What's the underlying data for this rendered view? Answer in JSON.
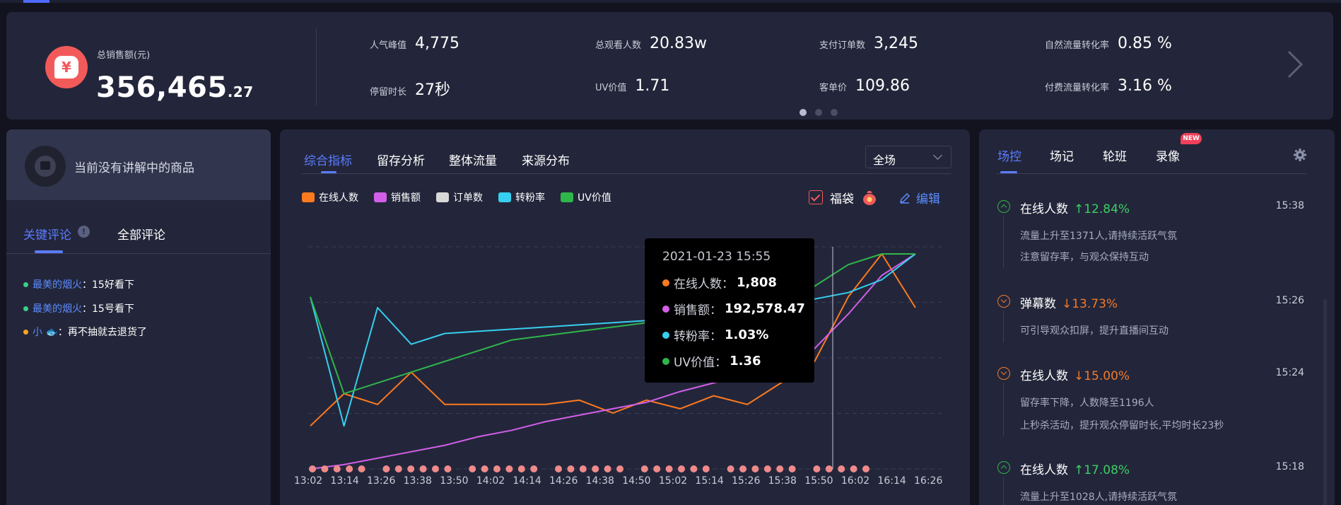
{
  "summary": {
    "total_label": "总销售额(元)",
    "total_int": "356,465",
    "total_dec": ".27",
    "stats": [
      {
        "label": "人气峰值",
        "value": "4,775"
      },
      {
        "label": "总观看人数",
        "value": "20.83w"
      },
      {
        "label": "支付订单数",
        "value": "3,245"
      },
      {
        "label": "自然流量转化率",
        "value": "0.85 %"
      },
      {
        "label": "停留时长",
        "value": "27秒"
      },
      {
        "label": "UV价值",
        "value": "1.71"
      },
      {
        "label": "客单价",
        "value": "109.86"
      },
      {
        "label": "付费流量转化率",
        "value": "3.16 %"
      }
    ]
  },
  "left": {
    "no_product": "当前没有讲解中的商品",
    "tab_key": "关键评论",
    "tab_all": "全部评论",
    "comments": [
      {
        "user": "最美的烟火",
        "text": "15好看下",
        "color": "#3ccf86"
      },
      {
        "user": "最美的烟火",
        "text": "15号看下",
        "color": "#3ccf86"
      },
      {
        "user": "小 🐟",
        "text": "再不抽就去退货了",
        "color": "#f5a623"
      }
    ]
  },
  "center": {
    "tabs": [
      "综合指标",
      "留存分析",
      "整体流量",
      "来源分布"
    ],
    "select_value": "全场",
    "legend": [
      {
        "name": "在线人数",
        "color": "#ff7a1f"
      },
      {
        "name": "销售额",
        "color": "#d35fe8"
      },
      {
        "name": "订单数",
        "color": "#d8d8d8"
      },
      {
        "name": "转粉率",
        "color": "#36cfef"
      },
      {
        "name": "UV价值",
        "color": "#2fb64a"
      }
    ],
    "fudai": "福袋",
    "edit": "编辑",
    "tooltip": {
      "date": "2021-01-23 15:55",
      "rows": [
        {
          "name": "在线人数",
          "value": "1,808",
          "color": "#ff7a1f"
        },
        {
          "name": "销售额",
          "value": "192,578.47",
          "color": "#d35fe8"
        },
        {
          "name": "转粉率",
          "value": "1.03%",
          "color": "#36cfef"
        },
        {
          "name": "UV价值",
          "value": "1.36",
          "color": "#2fb64a"
        }
      ]
    }
  },
  "chart_data": {
    "type": "line",
    "x_ticks": [
      "13:02",
      "13:14",
      "13:26",
      "13:38",
      "13:50",
      "14:02",
      "14:14",
      "14:26",
      "14:38",
      "14:50",
      "15:02",
      "15:14",
      "15:26",
      "15:38",
      "15:50",
      "16:02",
      "16:14",
      "16:26"
    ],
    "series": [
      {
        "name": "在线人数",
        "color": "#ff7a1f",
        "values": [
          0.2,
          0.35,
          0.3,
          0.45,
          0.3,
          0.3,
          0.3,
          0.3,
          0.32,
          0.26,
          0.32,
          0.28,
          0.34,
          0.3,
          0.4,
          0.5,
          0.8,
          1.0,
          0.75
        ]
      },
      {
        "name": "销售额",
        "color": "#d35fe8",
        "values": [
          0.0,
          0.02,
          0.05,
          0.08,
          0.11,
          0.15,
          0.18,
          0.22,
          0.25,
          0.28,
          0.31,
          0.36,
          0.4,
          0.44,
          0.48,
          0.56,
          0.72,
          0.9,
          1.0
        ]
      },
      {
        "name": "转粉率",
        "color": "#36cfef",
        "values": [
          0.8,
          0.2,
          0.75,
          0.58,
          0.63,
          0.64,
          0.65,
          0.66,
          0.67,
          0.68,
          0.69,
          0.71,
          0.72,
          0.74,
          0.76,
          0.79,
          0.82,
          0.88,
          1.0
        ]
      },
      {
        "name": "UV价值",
        "color": "#2fb64a",
        "values": [
          0.8,
          0.35,
          0.4,
          0.45,
          0.5,
          0.55,
          0.6,
          0.62,
          0.64,
          0.66,
          0.68,
          0.7,
          0.72,
          0.76,
          0.8,
          0.85,
          0.95,
          1.0,
          1.0
        ]
      }
    ],
    "grid": true
  },
  "right": {
    "tabs": [
      "场控",
      "场记",
      "轮班",
      "录像"
    ],
    "new_badge": "NEW",
    "events": [
      {
        "title": "在线人数",
        "change": "↑12.84%",
        "dir": "up",
        "time": "15:38",
        "lines": [
          "流量上升至1371人,请持续活跃气氛",
          "注意留存率，与观众保持互动"
        ]
      },
      {
        "title": "弹幕数",
        "change": "↓13.73%",
        "dir": "down",
        "time": "15:26",
        "lines": [
          "可引导观众扣屏，提升直播间互动"
        ]
      },
      {
        "title": "在线人数",
        "change": "↓15.00%",
        "dir": "down",
        "time": "15:24",
        "lines": [
          "留存率下降，人数降至1196人",
          "上秒杀活动，提升观众停留时长,平均时长23秒"
        ]
      },
      {
        "title": "在线人数",
        "change": "↑17.08%",
        "dir": "up",
        "time": "15:18",
        "lines": [
          "流量上升至1028人,请持续活跃气氛"
        ]
      }
    ]
  }
}
